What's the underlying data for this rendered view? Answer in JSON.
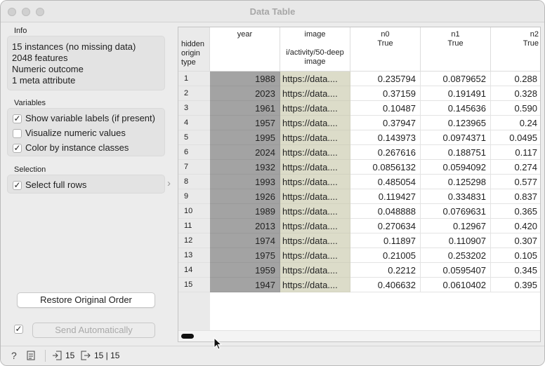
{
  "window": {
    "title": "Data Table"
  },
  "info": {
    "label": "Info",
    "lines": [
      "15 instances (no missing data)",
      "2048 features",
      "Numeric outcome",
      "1 meta attribute"
    ]
  },
  "variables": {
    "label": "Variables",
    "options": [
      {
        "label": "Show variable labels (if present)",
        "checked": true
      },
      {
        "label": "Visualize numeric values",
        "checked": false
      },
      {
        "label": "Color by instance classes",
        "checked": true
      }
    ]
  },
  "selection": {
    "label": "Selection",
    "options": [
      {
        "label": "Select full rows",
        "checked": true
      }
    ]
  },
  "buttons": {
    "restore": "Restore Original Order",
    "send": "Send Automatically",
    "auto_send_checked": true
  },
  "table": {
    "corner_header": [
      "hidden",
      "origin",
      "type"
    ],
    "columns": [
      {
        "name": "year",
        "sub": "",
        "sub2": ""
      },
      {
        "name": "image",
        "sub": "",
        "sub2": "i/activity/50-deep",
        "sub3": "image"
      },
      {
        "name": "n0",
        "sub": "True"
      },
      {
        "name": "n1",
        "sub": "True"
      },
      {
        "name": "n2",
        "sub": "True"
      }
    ],
    "rows": [
      {
        "idx": "1",
        "year": "1988",
        "image": "https://data....",
        "n0": "0.235794",
        "n1": "0.0879652",
        "n2": "0.288"
      },
      {
        "idx": "2",
        "year": "2023",
        "image": "https://data....",
        "n0": "0.37159",
        "n1": "0.191491",
        "n2": "0.328"
      },
      {
        "idx": "3",
        "year": "1961",
        "image": "https://data....",
        "n0": "0.10487",
        "n1": "0.145636",
        "n2": "0.590"
      },
      {
        "idx": "4",
        "year": "1957",
        "image": "https://data....",
        "n0": "0.37947",
        "n1": "0.123965",
        "n2": "0.24"
      },
      {
        "idx": "5",
        "year": "1995",
        "image": "https://data....",
        "n0": "0.143973",
        "n1": "0.0974371",
        "n2": "0.0495"
      },
      {
        "idx": "6",
        "year": "2024",
        "image": "https://data....",
        "n0": "0.267616",
        "n1": "0.188751",
        "n2": "0.117"
      },
      {
        "idx": "7",
        "year": "1932",
        "image": "https://data....",
        "n0": "0.0856132",
        "n1": "0.0594092",
        "n2": "0.274"
      },
      {
        "idx": "8",
        "year": "1993",
        "image": "https://data....",
        "n0": "0.485054",
        "n1": "0.125298",
        "n2": "0.577"
      },
      {
        "idx": "9",
        "year": "1926",
        "image": "https://data....",
        "n0": "0.119427",
        "n1": "0.334831",
        "n2": "0.837"
      },
      {
        "idx": "10",
        "year": "1989",
        "image": "https://data....",
        "n0": "0.048888",
        "n1": "0.0769631",
        "n2": "0.365"
      },
      {
        "idx": "11",
        "year": "2013",
        "image": "https://data....",
        "n0": "0.270634",
        "n1": "0.12967",
        "n2": "0.420"
      },
      {
        "idx": "12",
        "year": "1974",
        "image": "https://data....",
        "n0": "0.11897",
        "n1": "0.110907",
        "n2": "0.307"
      },
      {
        "idx": "13",
        "year": "1975",
        "image": "https://data....",
        "n0": "0.21005",
        "n1": "0.253202",
        "n2": "0.105"
      },
      {
        "idx": "14",
        "year": "1959",
        "image": "https://data....",
        "n0": "0.2212",
        "n1": "0.0595407",
        "n2": "0.345"
      },
      {
        "idx": "15",
        "year": "1947",
        "image": "https://data....",
        "n0": "0.406632",
        "n1": "0.0610402",
        "n2": "0.395"
      }
    ]
  },
  "statusbar": {
    "input_count": "15",
    "output_count": "15 | 15"
  },
  "colors": {
    "year_column": "#a3a3a3",
    "image_column": "#dcdcc9"
  }
}
